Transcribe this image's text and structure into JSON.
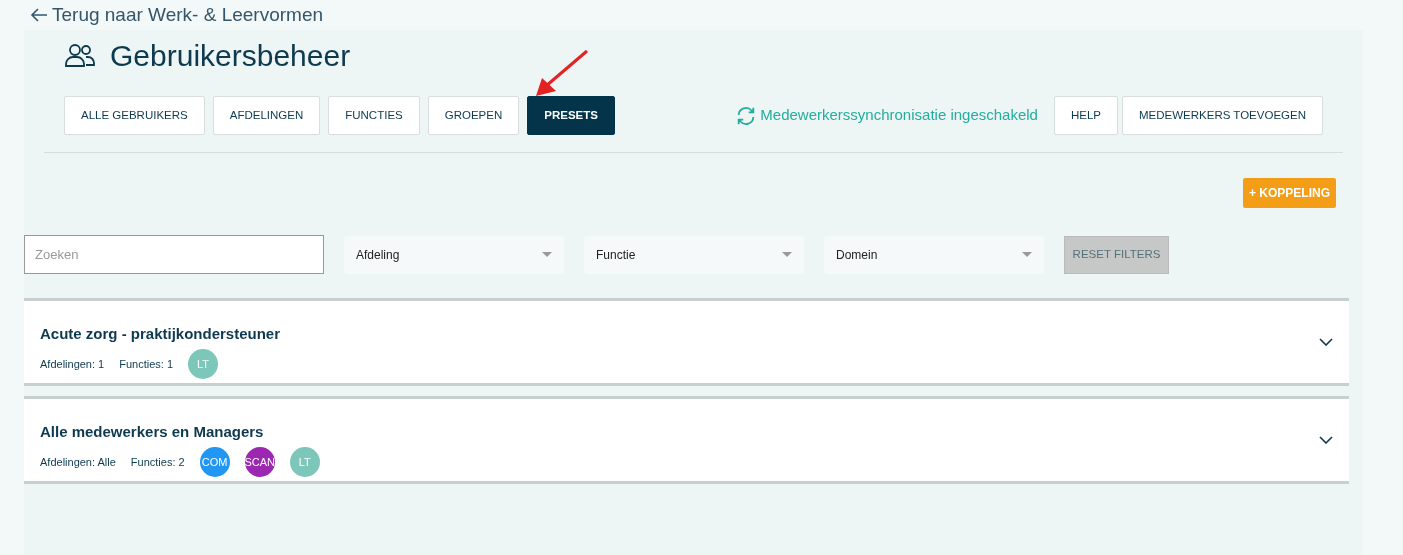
{
  "back_link": "Terug naar Werk- & Leervormen",
  "title": "Gebruikersbeheer",
  "tabs": [
    {
      "label": "ALLE GEBRUIKERS",
      "selected": false
    },
    {
      "label": "AFDELINGEN",
      "selected": false
    },
    {
      "label": "FUNCTIES",
      "selected": false
    },
    {
      "label": "GROEPEN",
      "selected": false
    },
    {
      "label": "PRESETS",
      "selected": true
    }
  ],
  "sync_status": "Medewerkerssynchronisatie ingeschakeld",
  "header_buttons": [
    "HELP",
    "MEDEWERKERS TOEVOEGEN"
  ],
  "add_button": "+ KOPPELING",
  "search": {
    "placeholder": "Zoeken"
  },
  "filters": [
    "Afdeling",
    "Functie",
    "Domein"
  ],
  "reset_button": {
    "label": "RESET FILTERS",
    "disabled": true
  },
  "presets": [
    {
      "name": "Acute zorg - praktijkondersteuner",
      "departments": "Afdelingen: 1",
      "functions": "Functies: 1",
      "badges": [
        {
          "label": "LT",
          "color": "#7cc6ba"
        }
      ]
    },
    {
      "name": "Alle medewerkers en Managers",
      "departments": "Afdelingen: Alle",
      "functions": "Functies: 2",
      "badges": [
        {
          "label": "COM",
          "color": "#2196f3"
        },
        {
          "label": "SCAN",
          "color": "#9c27b0"
        },
        {
          "label": "LT",
          "color": "#7cc6ba"
        }
      ]
    }
  ]
}
